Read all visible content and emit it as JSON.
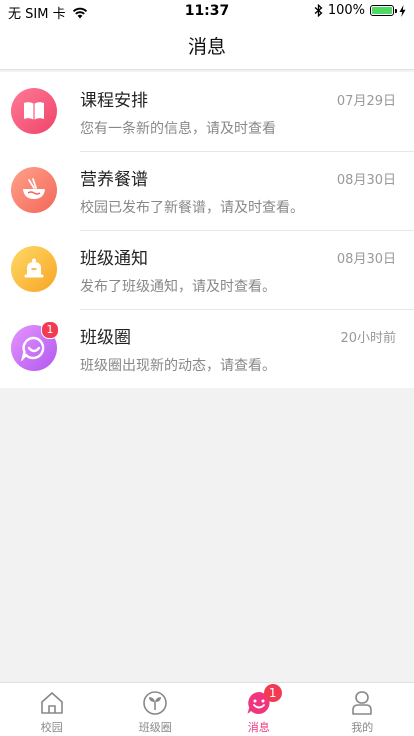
{
  "status_bar": {
    "carrier": "无 SIM 卡",
    "time": "11:37",
    "battery": "100%",
    "battery_level": 1.0
  },
  "header": {
    "title": "消息"
  },
  "messages": [
    {
      "title": "课程安排",
      "time": "07月29日",
      "subtitle": "您有一条新的信息，请及时查看",
      "icon": "book-icon",
      "color_from": "#ff6f8f",
      "color_to": "#f2476a"
    },
    {
      "title": "营养餐谱",
      "time": "08月30日",
      "subtitle": "校园已发布了新餐谱，请及时查看。",
      "icon": "noodle-bowl-icon",
      "color_from": "#ff9a80",
      "color_to": "#f46a5b"
    },
    {
      "title": "班级通知",
      "time": "08月30日",
      "subtitle": "发布了班级通知，请及时查看。",
      "icon": "bell-icon",
      "color_from": "#ffd45c",
      "color_to": "#f8a925"
    },
    {
      "title": "班级圈",
      "time": "20小时前",
      "subtitle": "班级圈出现新的动态，请查看。",
      "icon": "chat-smile-icon",
      "color_from": "#e08cff",
      "color_to": "#b45bf2",
      "badge": "1"
    }
  ],
  "tabbar": {
    "items": [
      {
        "label": "校园",
        "icon": "house-icon",
        "active": false
      },
      {
        "label": "班级圈",
        "icon": "sprout-icon",
        "active": false
      },
      {
        "label": "消息",
        "icon": "message-smile-icon",
        "active": true,
        "badge": "1"
      },
      {
        "label": "我的",
        "icon": "person-icon",
        "active": false
      }
    ]
  }
}
